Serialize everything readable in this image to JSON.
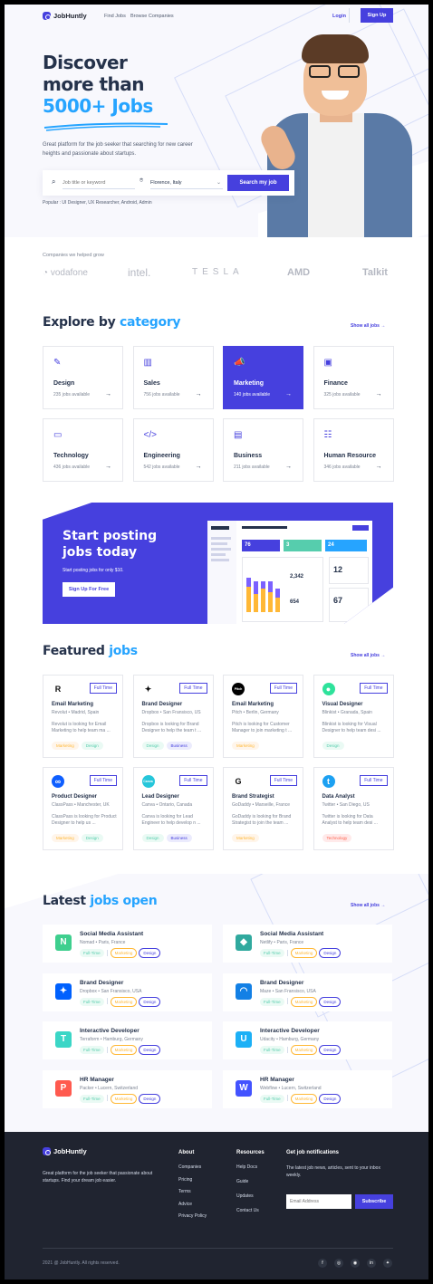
{
  "nav": {
    "brand": "JobHuntly",
    "links": [
      "Find Jobs",
      "Browse Companies"
    ],
    "login": "Login",
    "signup": "Sign Up"
  },
  "hero": {
    "title_line1": "Discover",
    "title_line2": "more than",
    "title_line3": "5000+ Jobs",
    "subtitle": "Great platform for the job seeker that searching for new career heights and passionate about startups.",
    "search_placeholder": "Job title or keyword",
    "location_value": "Florence, Italy",
    "search_button": "Search my job",
    "popular": "Popular : UI Designer, UX Researcher, Android, Admin"
  },
  "companies": {
    "label": "Companies we helped grow",
    "names": [
      "vodafone",
      "intel.",
      "TESLA",
      "AMD",
      "Talkit"
    ]
  },
  "categories": {
    "title_plain": "Explore by",
    "title_accent": "category",
    "show_all": "Show all jobs",
    "items": [
      {
        "name": "Design",
        "count": "235 jobs available",
        "icon": "design-icon",
        "glyph": "✎"
      },
      {
        "name": "Sales",
        "count": "756 jobs available",
        "icon": "chart-icon",
        "glyph": "▥"
      },
      {
        "name": "Marketing",
        "count": "140 jobs available",
        "icon": "megaphone-icon",
        "glyph": "📣"
      },
      {
        "name": "Finance",
        "count": "325 jobs available",
        "icon": "wallet-icon",
        "glyph": "▣"
      },
      {
        "name": "Technology",
        "count": "436 jobs available",
        "icon": "monitor-icon",
        "glyph": "▭"
      },
      {
        "name": "Engineering",
        "count": "542 jobs available",
        "icon": "code-icon",
        "glyph": "</>"
      },
      {
        "name": "Business",
        "count": "211 jobs available",
        "icon": "briefcase-icon",
        "glyph": "▤"
      },
      {
        "name": "Human Resource",
        "count": "346 jobs available",
        "icon": "users-icon",
        "glyph": "☷"
      }
    ]
  },
  "cta": {
    "title_line1": "Start posting",
    "title_line2": "jobs today",
    "subtitle": "Start posting jobs for only $10.",
    "button": "Sign Up For Free",
    "dash_stats": [
      {
        "num": "76",
        "label": "New candidates to review"
      },
      {
        "num": "3",
        "label": "Schedule for today"
      },
      {
        "num": "24",
        "label": "Messages received"
      }
    ],
    "dash_numbers": [
      "2,342",
      "654",
      "12",
      "67"
    ]
  },
  "featured": {
    "title_plain": "Featured",
    "title_accent": "jobs",
    "show_all": "Show all jobs",
    "items": [
      {
        "title": "Email Marketing",
        "company": "Revolut",
        "location": "Madrid, Spain",
        "type": "Full Time",
        "desc": "Revolut is looking for Email Marketing to help team ma ...",
        "tags": [
          "Marketing",
          "Design"
        ],
        "logo_color": "#ffffff",
        "logo_text": "R",
        "icon": "revolut-logo-icon"
      },
      {
        "title": "Brand Designer",
        "company": "Dropbox",
        "location": "San Fransisco, US",
        "type": "Full Time",
        "desc": "Dropbox is looking for Brand Designer to help the team t ...",
        "tags": [
          "Design",
          "Business"
        ],
        "logo_color": "#ffffff",
        "logo_text": "✦",
        "icon": "dropbox-logo-icon"
      },
      {
        "title": "Email Marketing",
        "company": "Pitch",
        "location": "Berlin, Germany",
        "type": "Full Time",
        "desc": "Pitch is looking for Customer Manager to join marketing t ...",
        "tags": [
          "Marketing"
        ],
        "logo_color": "#000000",
        "logo_text": "Pitch",
        "icon": "pitch-logo-icon"
      },
      {
        "title": "Visual Designer",
        "company": "Blinkist",
        "location": "Granada, Spain",
        "type": "Full Time",
        "desc": "Blinkist is looking for Visual Designer to help team desi ...",
        "tags": [
          "Design"
        ],
        "logo_color": "#2ee29b",
        "logo_text": "●",
        "icon": "blinkist-logo-icon"
      },
      {
        "title": "Product Designer",
        "company": "ClassPass",
        "location": "Manchester, UK",
        "type": "Full Time",
        "desc": "ClassPass is looking for Product Designer to help us ...",
        "tags": [
          "Marketing",
          "Design"
        ],
        "logo_color": "#0f5fff",
        "logo_text": "∞",
        "icon": "classpass-logo-icon"
      },
      {
        "title": "Lead Designer",
        "company": "Canva",
        "location": "Ontario, Canada",
        "type": "Full Time",
        "desc": "Canva is looking for Lead Engineer to help develop n ...",
        "tags": [
          "Design",
          "Business"
        ],
        "logo_color": "#26c6da",
        "logo_text": "Canva",
        "icon": "canva-logo-icon"
      },
      {
        "title": "Brand Strategist",
        "company": "GoDaddy",
        "location": "Marseille, France",
        "type": "Full Time",
        "desc": "GoDaddy is looking for Brand Strategist to join the team ...",
        "tags": [
          "Marketing"
        ],
        "logo_color": "#ffffff",
        "logo_text": "G",
        "icon": "godaddy-logo-icon"
      },
      {
        "title": "Data Analyst",
        "company": "Twitter",
        "location": "San Diego, US",
        "type": "Full Time",
        "desc": "Twitter is looking for Data Analyst to help team desi ...",
        "tags": [
          "Technology"
        ],
        "logo_color": "#1da1f2",
        "logo_text": "t",
        "icon": "twitter-logo-icon"
      }
    ]
  },
  "latest": {
    "title_plain": "Latest",
    "title_accent": "jobs open",
    "show_all": "Show all jobs",
    "items": [
      {
        "title": "Social Media Assistant",
        "company": "Nomad",
        "location": "Paris, France",
        "logo_color": "#3ecf8e",
        "logo_text": "N",
        "icon": "nomad-logo-icon",
        "tags": [
          "Full-Time",
          "Marketing",
          "Design"
        ]
      },
      {
        "title": "Social Media Assistant",
        "company": "Netlify",
        "location": "Paris, France",
        "logo_color": "#30a99e",
        "logo_text": "◆",
        "icon": "netlify-logo-icon",
        "tags": [
          "Full-Time",
          "Marketing",
          "Design"
        ]
      },
      {
        "title": "Brand Designer",
        "company": "Dropbox",
        "location": "San Fransisco, USA",
        "logo_color": "#0061fe",
        "logo_text": "✦",
        "icon": "dropbox-logo-icon",
        "tags": [
          "Full-Time",
          "Marketing",
          "Design"
        ]
      },
      {
        "title": "Brand Designer",
        "company": "Maze",
        "location": "San Fransisco, USA",
        "logo_color": "#1380e5",
        "logo_text": "◠",
        "icon": "maze-logo-icon",
        "tags": [
          "Full-Time",
          "Marketing",
          "Design"
        ]
      },
      {
        "title": "Interactive Developer",
        "company": "Terraform",
        "location": "Hamburg, Germany",
        "logo_color": "#3bd6c6",
        "logo_text": "T",
        "icon": "terraform-logo-icon",
        "tags": [
          "Full-Time",
          "Marketing",
          "Design"
        ]
      },
      {
        "title": "Interactive Developer",
        "company": "Udacity",
        "location": "Hamburg, Germany",
        "logo_color": "#1cb0f6",
        "logo_text": "U",
        "icon": "udacity-logo-icon",
        "tags": [
          "Full-Time",
          "Marketing",
          "Design"
        ]
      },
      {
        "title": "HR Manager",
        "company": "Packer",
        "location": "Lucern, Switzerland",
        "logo_color": "#ff5a4f",
        "logo_text": "P",
        "icon": "packer-logo-icon",
        "tags": [
          "Full-Time",
          "Marketing",
          "Design"
        ]
      },
      {
        "title": "HR Manager",
        "company": "Webflow",
        "location": "Lucern, Switzerland",
        "logo_color": "#4353ff",
        "logo_text": "W",
        "icon": "webflow-logo-icon",
        "tags": [
          "Full-Time",
          "Marketing",
          "Design"
        ]
      }
    ]
  },
  "footer": {
    "brand": "JobHuntly",
    "about_text": "Great platform for the job seeker that passionate about startups. Find your dream job easier.",
    "col1": {
      "title": "About",
      "links": [
        "Companies",
        "Pricing",
        "Terms",
        "Advice",
        "Privacy Policy"
      ]
    },
    "col2": {
      "title": "Resources",
      "links": [
        "Help Docs",
        "Guide",
        "Updates",
        "Contact Us"
      ]
    },
    "newsletter": {
      "title": "Get job notifications",
      "text": "The latest job news, articles, sent to your inbox weekly.",
      "placeholder": "Email Address",
      "button": "Subscribe"
    },
    "copyright": "2021 @ JobHuntly. All rights reserved.",
    "socials": [
      "f",
      "◎",
      "◉",
      "in",
      "✦"
    ]
  },
  "colors": {
    "primary": "#4640de",
    "accent": "#26a4ff",
    "dark": "#202430"
  }
}
